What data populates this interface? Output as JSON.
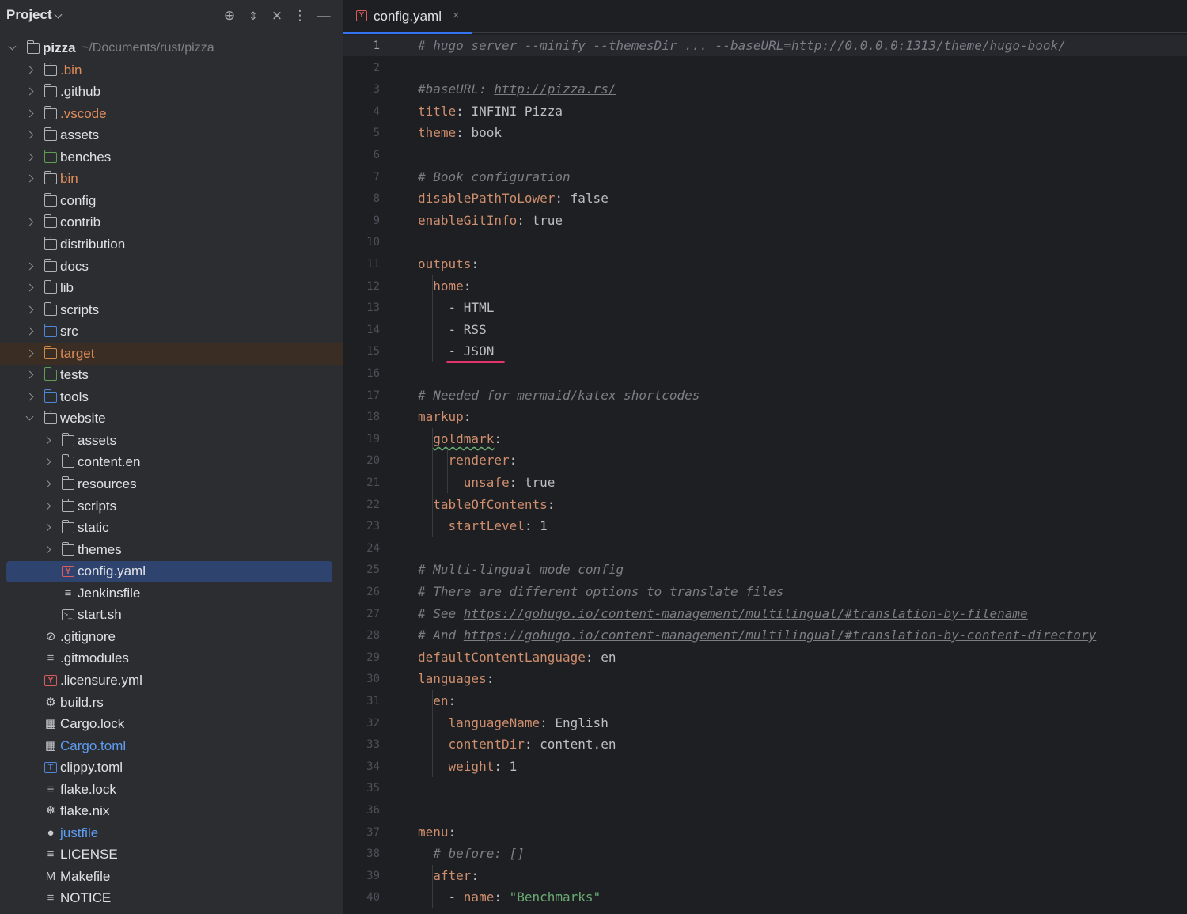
{
  "project_panel": {
    "title": "Project",
    "header_icons": [
      "crosshair-icon",
      "expand-collapse-icon",
      "close-all-icon",
      "more-icon",
      "minimize-icon"
    ],
    "root": {
      "name": "pizza",
      "path": "~/Documents/rust/pizza"
    },
    "items": [
      {
        "label": ".bin"
      },
      {
        "label": ".github"
      },
      {
        "label": ".vscode"
      },
      {
        "label": "assets"
      },
      {
        "label": "benches"
      },
      {
        "label": "bin"
      },
      {
        "label": "config"
      },
      {
        "label": "contrib"
      },
      {
        "label": "distribution"
      },
      {
        "label": "docs"
      },
      {
        "label": "lib"
      },
      {
        "label": "scripts"
      },
      {
        "label": "src"
      },
      {
        "label": "target"
      },
      {
        "label": "tests"
      },
      {
        "label": "tools"
      },
      {
        "label": "website"
      },
      {
        "label": "assets"
      },
      {
        "label": "content.en"
      },
      {
        "label": "resources"
      },
      {
        "label": "scripts"
      },
      {
        "label": "static"
      },
      {
        "label": "themes"
      },
      {
        "label": "config.yaml"
      },
      {
        "label": "Jenkinsfile"
      },
      {
        "label": "start.sh"
      },
      {
        "label": ".gitignore"
      },
      {
        "label": ".gitmodules"
      },
      {
        "label": ".licensure.yml"
      },
      {
        "label": "build.rs"
      },
      {
        "label": "Cargo.lock"
      },
      {
        "label": "Cargo.toml"
      },
      {
        "label": "clippy.toml"
      },
      {
        "label": "flake.lock"
      },
      {
        "label": "flake.nix"
      },
      {
        "label": "justfile"
      },
      {
        "label": "LICENSE"
      },
      {
        "label": "Makefile"
      },
      {
        "label": "NOTICE"
      }
    ]
  },
  "editor": {
    "tab": {
      "label": "config.yaml",
      "close": "×",
      "icon_letter": "Y"
    },
    "lines": [
      {
        "n": "1",
        "tokens": [
          [
            "c",
            "# hugo server --minify --themesDir ... --baseURL="
          ],
          [
            "u",
            "http://0.0.0.0:1313/theme/hugo-book/"
          ]
        ]
      },
      {
        "n": "2",
        "tokens": []
      },
      {
        "n": "3",
        "tokens": [
          [
            "c",
            "#baseURL: "
          ],
          [
            "u",
            "http://pizza.rs/"
          ]
        ]
      },
      {
        "n": "4",
        "tokens": [
          [
            "k",
            "title"
          ],
          [
            "p",
            ": "
          ],
          [
            "v",
            "INFINI Pizza"
          ]
        ]
      },
      {
        "n": "5",
        "tokens": [
          [
            "k",
            "theme"
          ],
          [
            "p",
            ": "
          ],
          [
            "v",
            "book"
          ]
        ]
      },
      {
        "n": "6",
        "tokens": []
      },
      {
        "n": "7",
        "tokens": [
          [
            "c",
            "# Book configuration"
          ]
        ]
      },
      {
        "n": "8",
        "tokens": [
          [
            "k",
            "disablePathToLower"
          ],
          [
            "p",
            ": "
          ],
          [
            "v",
            "false"
          ]
        ]
      },
      {
        "n": "9",
        "tokens": [
          [
            "k",
            "enableGitInfo"
          ],
          [
            "p",
            ": "
          ],
          [
            "v",
            "true"
          ]
        ]
      },
      {
        "n": "10",
        "tokens": []
      },
      {
        "n": "11",
        "tokens": [
          [
            "k",
            "outputs"
          ],
          [
            "p",
            ":"
          ]
        ]
      },
      {
        "n": "12",
        "tokens": [
          [
            "p",
            "  "
          ],
          [
            "k",
            "home"
          ],
          [
            "p",
            ":"
          ]
        ]
      },
      {
        "n": "13",
        "tokens": [
          [
            "p",
            "    - "
          ],
          [
            "v",
            "HTML"
          ]
        ]
      },
      {
        "n": "14",
        "tokens": [
          [
            "p",
            "    - "
          ],
          [
            "v",
            "RSS"
          ]
        ]
      },
      {
        "n": "15",
        "tokens": [
          [
            "p",
            "    - "
          ],
          [
            "v",
            "JSON"
          ]
        ]
      },
      {
        "n": "16",
        "tokens": []
      },
      {
        "n": "17",
        "tokens": [
          [
            "c",
            "# Needed for mermaid/katex shortcodes"
          ]
        ]
      },
      {
        "n": "18",
        "tokens": [
          [
            "k",
            "markup"
          ],
          [
            "p",
            ":"
          ]
        ]
      },
      {
        "n": "19",
        "tokens": [
          [
            "p",
            "  "
          ],
          [
            "k typo",
            "goldmark"
          ],
          [
            "p",
            ":"
          ]
        ]
      },
      {
        "n": "20",
        "tokens": [
          [
            "p",
            "    "
          ],
          [
            "k",
            "renderer"
          ],
          [
            "p",
            ":"
          ]
        ]
      },
      {
        "n": "21",
        "tokens": [
          [
            "p",
            "      "
          ],
          [
            "k",
            "unsafe"
          ],
          [
            "p",
            ": "
          ],
          [
            "v",
            "true"
          ]
        ]
      },
      {
        "n": "22",
        "tokens": [
          [
            "p",
            "  "
          ],
          [
            "k",
            "tableOfContents"
          ],
          [
            "p",
            ":"
          ]
        ]
      },
      {
        "n": "23",
        "tokens": [
          [
            "p",
            "    "
          ],
          [
            "k",
            "startLevel"
          ],
          [
            "p",
            ": "
          ],
          [
            "v",
            "1"
          ]
        ]
      },
      {
        "n": "24",
        "tokens": []
      },
      {
        "n": "25",
        "tokens": [
          [
            "c",
            "# Multi-lingual mode config"
          ]
        ]
      },
      {
        "n": "26",
        "tokens": [
          [
            "c",
            "# There are different options to translate files"
          ]
        ]
      },
      {
        "n": "27",
        "tokens": [
          [
            "c",
            "# See "
          ],
          [
            "u",
            "https://gohugo.io/content-management/multilingual/#translation-by-filename"
          ]
        ]
      },
      {
        "n": "28",
        "tokens": [
          [
            "c",
            "# And "
          ],
          [
            "u",
            "https://gohugo.io/content-management/multilingual/#translation-by-content-directory"
          ]
        ]
      },
      {
        "n": "29",
        "tokens": [
          [
            "k",
            "defaultContentLanguage"
          ],
          [
            "p",
            ": "
          ],
          [
            "v",
            "en"
          ]
        ]
      },
      {
        "n": "30",
        "tokens": [
          [
            "k",
            "languages"
          ],
          [
            "p",
            ":"
          ]
        ]
      },
      {
        "n": "31",
        "tokens": [
          [
            "p",
            "  "
          ],
          [
            "k",
            "en"
          ],
          [
            "p",
            ":"
          ]
        ]
      },
      {
        "n": "32",
        "tokens": [
          [
            "p",
            "    "
          ],
          [
            "k",
            "languageName"
          ],
          [
            "p",
            ": "
          ],
          [
            "v",
            "English"
          ]
        ]
      },
      {
        "n": "33",
        "tokens": [
          [
            "p",
            "    "
          ],
          [
            "k",
            "contentDir"
          ],
          [
            "p",
            ": "
          ],
          [
            "v",
            "content.en"
          ]
        ]
      },
      {
        "n": "34",
        "tokens": [
          [
            "p",
            "    "
          ],
          [
            "k",
            "weight"
          ],
          [
            "p",
            ": "
          ],
          [
            "v",
            "1"
          ]
        ]
      },
      {
        "n": "35",
        "tokens": []
      },
      {
        "n": "36",
        "tokens": []
      },
      {
        "n": "37",
        "tokens": [
          [
            "k",
            "menu"
          ],
          [
            "p",
            ":"
          ]
        ]
      },
      {
        "n": "38",
        "tokens": [
          [
            "p",
            "  "
          ],
          [
            "c",
            "# before: []"
          ]
        ]
      },
      {
        "n": "39",
        "tokens": [
          [
            "p",
            "  "
          ],
          [
            "k",
            "after"
          ],
          [
            "p",
            ":"
          ]
        ]
      },
      {
        "n": "40",
        "tokens": [
          [
            "p",
            "    - "
          ],
          [
            "k",
            "name"
          ],
          [
            "p",
            ": "
          ],
          [
            "s",
            "\"Benchmarks\""
          ]
        ]
      }
    ]
  }
}
